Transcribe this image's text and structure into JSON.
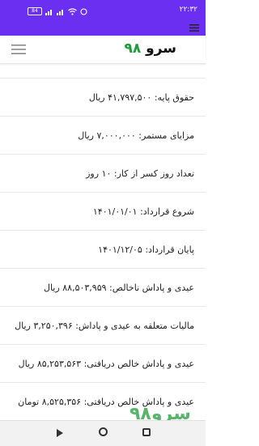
{
  "status_bar": {
    "time": "۲۲:۳۲",
    "battery": "84"
  },
  "app_bar": {
    "logo_word": "سرو",
    "logo_number": "۹۸"
  },
  "rows": [
    "",
    "حقوق پایه: ۴۱,۷۹۷,۵۰۰ ریال",
    "مزایای مستمر: ۷,۰۰۰,۰۰۰ ریال",
    "تعداد روز کسر از کار: ۱۰ روز",
    "شروع قرارداد: ۱۴۰۱/۰۱/۰۱",
    "پایان قرارداد: ۱۴۰۱/۱۲/۰۵",
    "عیدی و پاداش ناخالص: ۸۸,۵۰۳,۹۵۹ ریال",
    "مالیات متعلقه به عیدی و پاداش: ۳,۲۵۰,۳۹۶ ریال",
    "عیدی و پاداش خالص دریافتی: ۸۵,۲۵۳,۵۶۳ ریال",
    "عیدی و پاداش خالص دریافتی: ۸,۵۲۵,۳۵۶ تومان"
  ],
  "watermark": "سرو۹۸",
  "colors": {
    "accent": "#6b2ff2",
    "brand_green": "#1f9b3a"
  },
  "icons": {
    "status_menu": "menu-icon",
    "app_menu": "hamburger-icon",
    "nav_back": "back-triangle-icon",
    "nav_home": "home-circle-icon",
    "nav_recent": "recent-square-icon"
  }
}
